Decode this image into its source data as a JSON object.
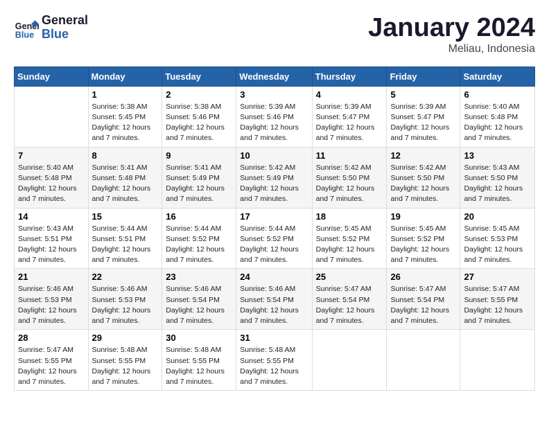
{
  "logo": {
    "line1": "General",
    "line2": "Blue"
  },
  "title": "January 2024",
  "location": "Meliau, Indonesia",
  "days_header": [
    "Sunday",
    "Monday",
    "Tuesday",
    "Wednesday",
    "Thursday",
    "Friday",
    "Saturday"
  ],
  "weeks": [
    [
      {
        "day": "",
        "info": ""
      },
      {
        "day": "1",
        "info": "Sunrise: 5:38 AM\nSunset: 5:45 PM\nDaylight: 12 hours\nand 7 minutes."
      },
      {
        "day": "2",
        "info": "Sunrise: 5:38 AM\nSunset: 5:46 PM\nDaylight: 12 hours\nand 7 minutes."
      },
      {
        "day": "3",
        "info": "Sunrise: 5:39 AM\nSunset: 5:46 PM\nDaylight: 12 hours\nand 7 minutes."
      },
      {
        "day": "4",
        "info": "Sunrise: 5:39 AM\nSunset: 5:47 PM\nDaylight: 12 hours\nand 7 minutes."
      },
      {
        "day": "5",
        "info": "Sunrise: 5:39 AM\nSunset: 5:47 PM\nDaylight: 12 hours\nand 7 minutes."
      },
      {
        "day": "6",
        "info": "Sunrise: 5:40 AM\nSunset: 5:48 PM\nDaylight: 12 hours\nand 7 minutes."
      }
    ],
    [
      {
        "day": "7",
        "info": "Sunrise: 5:40 AM\nSunset: 5:48 PM\nDaylight: 12 hours\nand 7 minutes."
      },
      {
        "day": "8",
        "info": "Sunrise: 5:41 AM\nSunset: 5:48 PM\nDaylight: 12 hours\nand 7 minutes."
      },
      {
        "day": "9",
        "info": "Sunrise: 5:41 AM\nSunset: 5:49 PM\nDaylight: 12 hours\nand 7 minutes."
      },
      {
        "day": "10",
        "info": "Sunrise: 5:42 AM\nSunset: 5:49 PM\nDaylight: 12 hours\nand 7 minutes."
      },
      {
        "day": "11",
        "info": "Sunrise: 5:42 AM\nSunset: 5:50 PM\nDaylight: 12 hours\nand 7 minutes."
      },
      {
        "day": "12",
        "info": "Sunrise: 5:42 AM\nSunset: 5:50 PM\nDaylight: 12 hours\nand 7 minutes."
      },
      {
        "day": "13",
        "info": "Sunrise: 5:43 AM\nSunset: 5:50 PM\nDaylight: 12 hours\nand 7 minutes."
      }
    ],
    [
      {
        "day": "14",
        "info": "Sunrise: 5:43 AM\nSunset: 5:51 PM\nDaylight: 12 hours\nand 7 minutes."
      },
      {
        "day": "15",
        "info": "Sunrise: 5:44 AM\nSunset: 5:51 PM\nDaylight: 12 hours\nand 7 minutes."
      },
      {
        "day": "16",
        "info": "Sunrise: 5:44 AM\nSunset: 5:52 PM\nDaylight: 12 hours\nand 7 minutes."
      },
      {
        "day": "17",
        "info": "Sunrise: 5:44 AM\nSunset: 5:52 PM\nDaylight: 12 hours\nand 7 minutes."
      },
      {
        "day": "18",
        "info": "Sunrise: 5:45 AM\nSunset: 5:52 PM\nDaylight: 12 hours\nand 7 minutes."
      },
      {
        "day": "19",
        "info": "Sunrise: 5:45 AM\nSunset: 5:52 PM\nDaylight: 12 hours\nand 7 minutes."
      },
      {
        "day": "20",
        "info": "Sunrise: 5:45 AM\nSunset: 5:53 PM\nDaylight: 12 hours\nand 7 minutes."
      }
    ],
    [
      {
        "day": "21",
        "info": "Sunrise: 5:46 AM\nSunset: 5:53 PM\nDaylight: 12 hours\nand 7 minutes."
      },
      {
        "day": "22",
        "info": "Sunrise: 5:46 AM\nSunset: 5:53 PM\nDaylight: 12 hours\nand 7 minutes."
      },
      {
        "day": "23",
        "info": "Sunrise: 5:46 AM\nSunset: 5:54 PM\nDaylight: 12 hours\nand 7 minutes."
      },
      {
        "day": "24",
        "info": "Sunrise: 5:46 AM\nSunset: 5:54 PM\nDaylight: 12 hours\nand 7 minutes."
      },
      {
        "day": "25",
        "info": "Sunrise: 5:47 AM\nSunset: 5:54 PM\nDaylight: 12 hours\nand 7 minutes."
      },
      {
        "day": "26",
        "info": "Sunrise: 5:47 AM\nSunset: 5:54 PM\nDaylight: 12 hours\nand 7 minutes."
      },
      {
        "day": "27",
        "info": "Sunrise: 5:47 AM\nSunset: 5:55 PM\nDaylight: 12 hours\nand 7 minutes."
      }
    ],
    [
      {
        "day": "28",
        "info": "Sunrise: 5:47 AM\nSunset: 5:55 PM\nDaylight: 12 hours\nand 7 minutes."
      },
      {
        "day": "29",
        "info": "Sunrise: 5:48 AM\nSunset: 5:55 PM\nDaylight: 12 hours\nand 7 minutes."
      },
      {
        "day": "30",
        "info": "Sunrise: 5:48 AM\nSunset: 5:55 PM\nDaylight: 12 hours\nand 7 minutes."
      },
      {
        "day": "31",
        "info": "Sunrise: 5:48 AM\nSunset: 5:55 PM\nDaylight: 12 hours\nand 7 minutes."
      },
      {
        "day": "",
        "info": ""
      },
      {
        "day": "",
        "info": ""
      },
      {
        "day": "",
        "info": ""
      }
    ]
  ]
}
